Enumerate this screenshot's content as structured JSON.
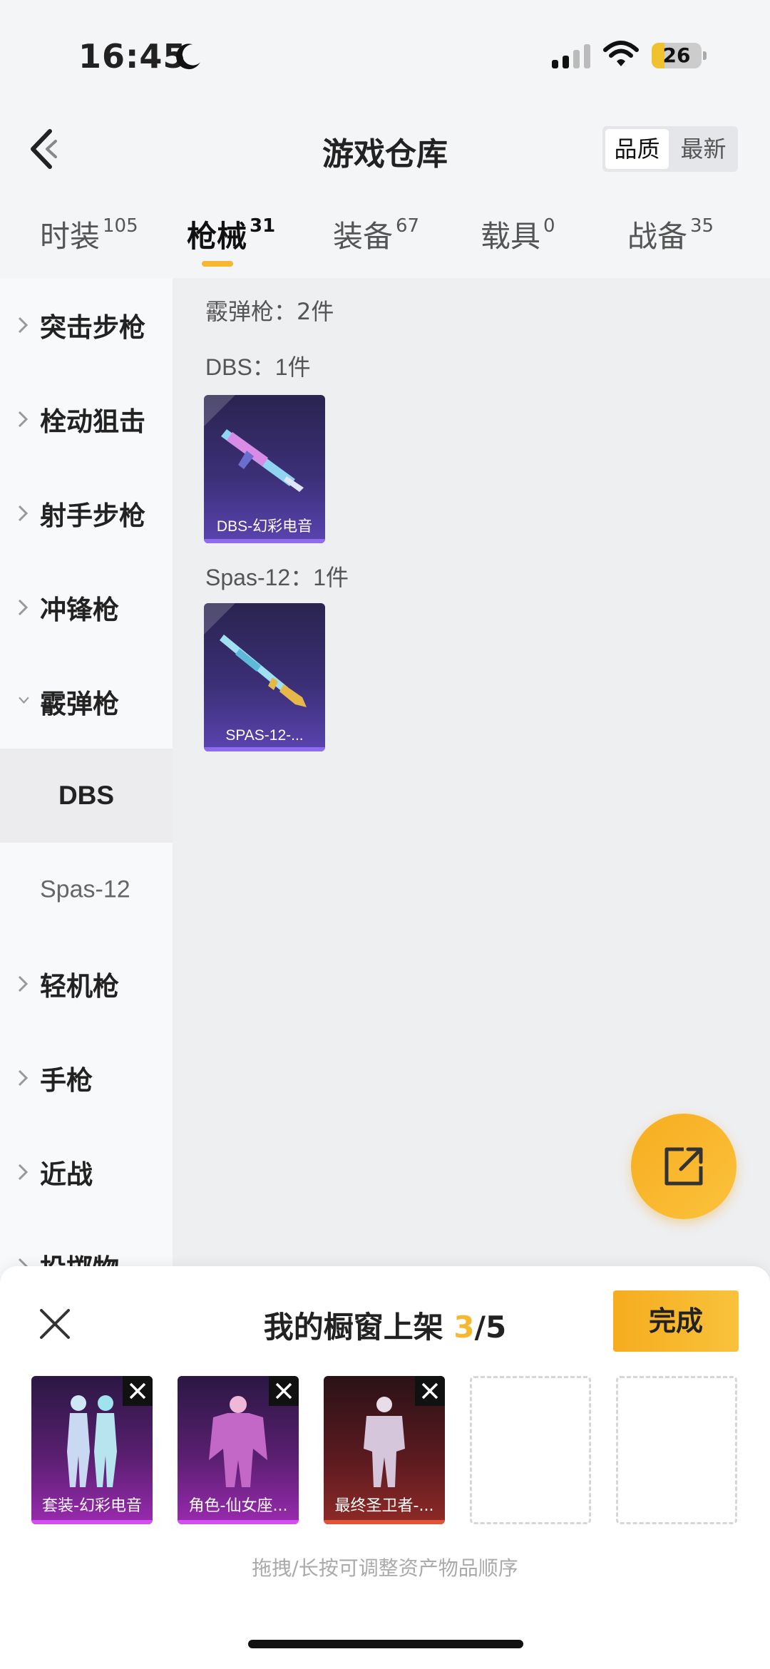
{
  "status_bar": {
    "time": "16:45",
    "battery": "26",
    "battery_level": 0.26
  },
  "header": {
    "title": "游戏仓库",
    "sort_options": [
      "品质",
      "最新"
    ],
    "active_sort": "品质"
  },
  "tabs": [
    {
      "label": "时装",
      "count": "105"
    },
    {
      "label": "枪械",
      "count": "31",
      "active": true
    },
    {
      "label": "装备",
      "count": "67"
    },
    {
      "label": "载具",
      "count": "0"
    },
    {
      "label": "战备",
      "count": "35"
    }
  ],
  "sidebar": {
    "items": [
      {
        "label": "突击步枪"
      },
      {
        "label": "栓动狙击"
      },
      {
        "label": "射手步枪"
      },
      {
        "label": "冲锋枪"
      },
      {
        "label": "霰弹枪",
        "expanded": true
      },
      {
        "label": "DBS",
        "selected": true
      },
      {
        "label": "Spas-12"
      },
      {
        "label": "轻机枪"
      },
      {
        "label": "手枪"
      },
      {
        "label": "近战"
      },
      {
        "label": "投掷物"
      }
    ]
  },
  "content": {
    "category_summary": "霰弹枪：2件",
    "groups": [
      {
        "label": "DBS：1件",
        "items": [
          {
            "name": "DBS-幻彩电音"
          }
        ]
      },
      {
        "label": "Spas-12：1件",
        "items": [
          {
            "name": "SPAS-12-..."
          }
        ]
      }
    ]
  },
  "showcase": {
    "title_prefix": "我的橱窗上架 ",
    "count": "3",
    "total": "/5",
    "done_label": "完成",
    "slots": [
      {
        "name": "套装-幻彩电音"
      },
      {
        "name": "角色-仙女座..."
      },
      {
        "name": "最终圣卫者-..."
      },
      {
        "name": ""
      },
      {
        "name": ""
      }
    ],
    "hint": "拖拽/长按可调整资产物品顺序"
  },
  "colors": {
    "accent": "#f5b82e",
    "card_purple": "#5a44b0",
    "card_pink": "#9a2ab0",
    "card_red": "#8e2a26"
  }
}
